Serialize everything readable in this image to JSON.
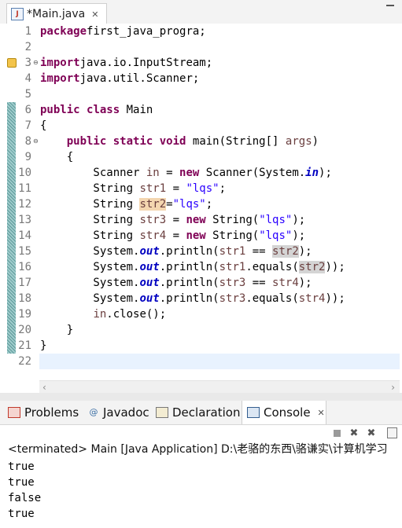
{
  "editor": {
    "tab": {
      "title": "*Main.java",
      "icon": "java-file-icon",
      "close_glyph": "✕"
    },
    "line_numbers": [
      "1",
      "2",
      "3",
      "4",
      "5",
      "6",
      "7",
      "8",
      "9",
      "10",
      "11",
      "12",
      "13",
      "14",
      "15",
      "16",
      "17",
      "18",
      "19",
      "20",
      "21",
      "22"
    ],
    "lines": [
      [
        [
          "kw",
          "package"
        ],
        [
          "",
          "first_java_progra;"
        ]
      ],
      [],
      [
        [
          "kw",
          "import"
        ],
        [
          "",
          "java.io.InputStream;"
        ]
      ],
      [
        [
          "kw",
          "import"
        ],
        [
          "",
          "java.util.Scanner;"
        ]
      ],
      [],
      [
        [
          "kw",
          "public"
        ],
        [
          "",
          " "
        ],
        [
          "kw",
          "class"
        ],
        [
          "",
          " Main"
        ]
      ],
      [
        [
          "",
          "{"
        ]
      ],
      [
        [
          "",
          "    "
        ],
        [
          "kw",
          "public"
        ],
        [
          "",
          " "
        ],
        [
          "kw",
          "static"
        ],
        [
          "",
          " "
        ],
        [
          "kw",
          "void"
        ],
        [
          "",
          " main(String[] "
        ],
        [
          "var",
          "args"
        ],
        [
          "",
          ")"
        ]
      ],
      [
        [
          "",
          "    {"
        ]
      ],
      [
        [
          "",
          "        Scanner "
        ],
        [
          "var",
          "in"
        ],
        [
          "",
          " = "
        ],
        [
          "kw",
          "new"
        ],
        [
          "",
          " Scanner(System."
        ],
        [
          "fld",
          "in"
        ],
        [
          "",
          ");"
        ]
      ],
      [
        [
          "",
          "        String "
        ],
        [
          "var",
          "str1"
        ],
        [
          "",
          " = "
        ],
        [
          "str",
          "\"lqs\""
        ],
        [
          "",
          ";"
        ]
      ],
      [
        [
          "",
          "        String "
        ],
        [
          "var hl",
          "str2"
        ],
        [
          "",
          "="
        ],
        [
          "str",
          "\"lqs\""
        ],
        [
          "",
          ";"
        ]
      ],
      [
        [
          "",
          "        String "
        ],
        [
          "var",
          "str3"
        ],
        [
          "",
          " = "
        ],
        [
          "kw",
          "new"
        ],
        [
          "",
          " String("
        ],
        [
          "str",
          "\"lqs\""
        ],
        [
          "",
          ");"
        ]
      ],
      [
        [
          "",
          "        String "
        ],
        [
          "var",
          "str4"
        ],
        [
          "",
          " = "
        ],
        [
          "kw",
          "new"
        ],
        [
          "",
          " String("
        ],
        [
          "str",
          "\"lqs\""
        ],
        [
          "",
          ");"
        ]
      ],
      [
        [
          "",
          "        System."
        ],
        [
          "fld",
          "out"
        ],
        [
          "",
          ".println("
        ],
        [
          "var",
          "str1"
        ],
        [
          "",
          " == "
        ],
        [
          "var occ",
          "str2"
        ],
        [
          "",
          ");"
        ]
      ],
      [
        [
          "",
          "        System."
        ],
        [
          "fld",
          "out"
        ],
        [
          "",
          ".println("
        ],
        [
          "var",
          "str1"
        ],
        [
          "",
          ".equals("
        ],
        [
          "var occ",
          "str2"
        ],
        [
          "",
          "));"
        ]
      ],
      [
        [
          "",
          "        System."
        ],
        [
          "fld",
          "out"
        ],
        [
          "",
          ".println("
        ],
        [
          "var",
          "str3"
        ],
        [
          "",
          " == "
        ],
        [
          "var",
          "str4"
        ],
        [
          "",
          ");"
        ]
      ],
      [
        [
          "",
          "        System."
        ],
        [
          "fld",
          "out"
        ],
        [
          "",
          ".println("
        ],
        [
          "var",
          "str3"
        ],
        [
          "",
          ".equals("
        ],
        [
          "var",
          "str4"
        ],
        [
          "",
          "));"
        ]
      ],
      [
        [
          "",
          "        "
        ],
        [
          "var",
          "in"
        ],
        [
          "",
          ".close();"
        ]
      ],
      [
        [
          "",
          "    }"
        ]
      ],
      [
        [
          "",
          "}"
        ]
      ],
      []
    ]
  },
  "views": {
    "tabs": [
      {
        "label": "Problems",
        "icon": "problems-icon"
      },
      {
        "label": "Javadoc",
        "icon": "javadoc-icon"
      },
      {
        "label": "Declaration",
        "icon": "declaration-icon"
      },
      {
        "label": "Console",
        "icon": "console-icon",
        "active": true
      }
    ],
    "close_glyph": "✕"
  },
  "console": {
    "status": "<terminated> Main [Java Application] D:\\老骆的东西\\骆谦实\\计算机学习",
    "output": [
      "true",
      "true",
      "false",
      "true"
    ]
  },
  "colors": {
    "keyword": "#7f0055",
    "string": "#2a00ff",
    "field": "#0000c0",
    "local_var": "#6a3e3e"
  }
}
